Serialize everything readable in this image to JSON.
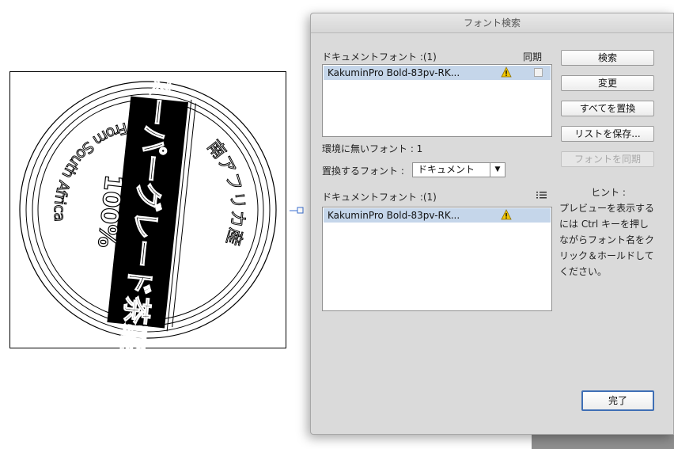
{
  "artwork": {
    "text_vertical": "スーパーグレード茶葉",
    "text_arc_left": "From South Africa",
    "text_arc_right": "南アフリカ産",
    "text_percent": "100%"
  },
  "dialog": {
    "title": "フォント検索",
    "doc_fonts_label": "ドキュメントフォント :(1)",
    "sync_column_label": "同期",
    "doc_fonts": [
      {
        "name": "KakuminPro Bold-83pv-RK...",
        "status": "warning-icon",
        "sync_checked": false
      }
    ],
    "missing_fonts_label": "環境に無いフォント : 1",
    "replace_label": "置換するフォント :",
    "replace_select_value": "ドキュメント",
    "replace_fonts_label": "ドキュメントフォント :(1)",
    "replace_fonts": [
      {
        "name": "KakuminPro Bold-83pv-RK...",
        "status": "warning-icon"
      }
    ],
    "buttons": {
      "find": "検索",
      "change": "変更",
      "change_all": "すべてを置換",
      "save_list": "リストを保存...",
      "sync_fonts": "フォントを同期"
    },
    "hint_title": "ヒント :",
    "hint_text": "プレビューを表示するには Ctrl キーを押しながらフォント名をクリック＆ホールドしてください。",
    "done": "完了"
  },
  "colors": {
    "selection": "#c5d6ea",
    "dialog_bg": "#dadada",
    "default_button_border": "#3f6fb5",
    "warning": "#f2c600"
  }
}
